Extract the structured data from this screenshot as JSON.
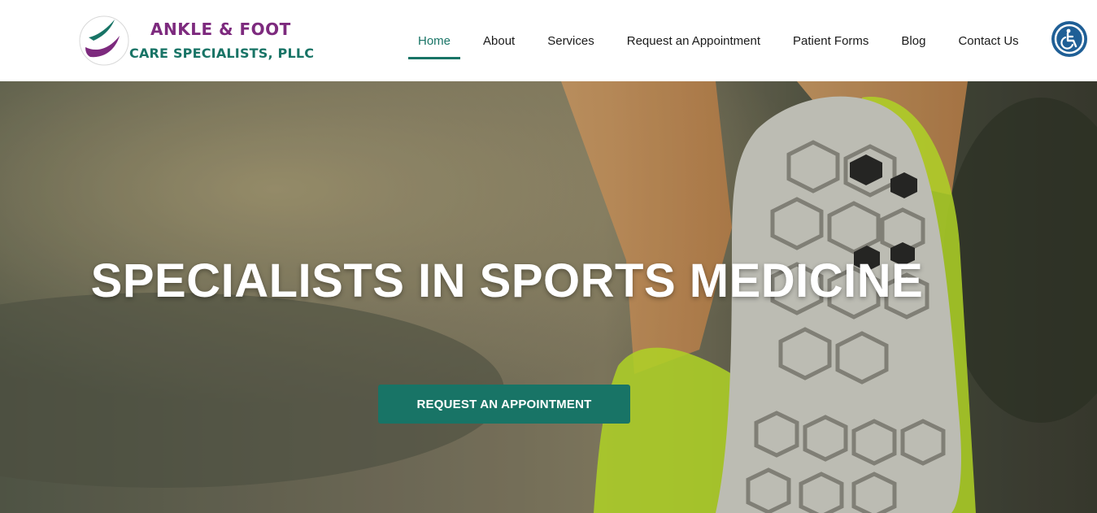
{
  "brand": {
    "line1": "ANKLE & FOOT",
    "line2": "CARE SPECIALISTS, PLLC",
    "purple": "#7d2a7e",
    "green": "#187466"
  },
  "nav": {
    "items": [
      {
        "label": "Home",
        "active": true
      },
      {
        "label": "About"
      },
      {
        "label": "Services"
      },
      {
        "label": "Request an Appointment"
      },
      {
        "label": "Patient Forms"
      },
      {
        "label": "Blog"
      },
      {
        "label": "Contact Us"
      }
    ],
    "accessibility_icon": "wheelchair-accessibility-icon",
    "accent": "#187466"
  },
  "hero": {
    "title": "SPECIALISTS IN SPORTS MEDICINE",
    "cta_label": "REQUEST AN APPOINTMENT",
    "cta_color": "#187466"
  }
}
